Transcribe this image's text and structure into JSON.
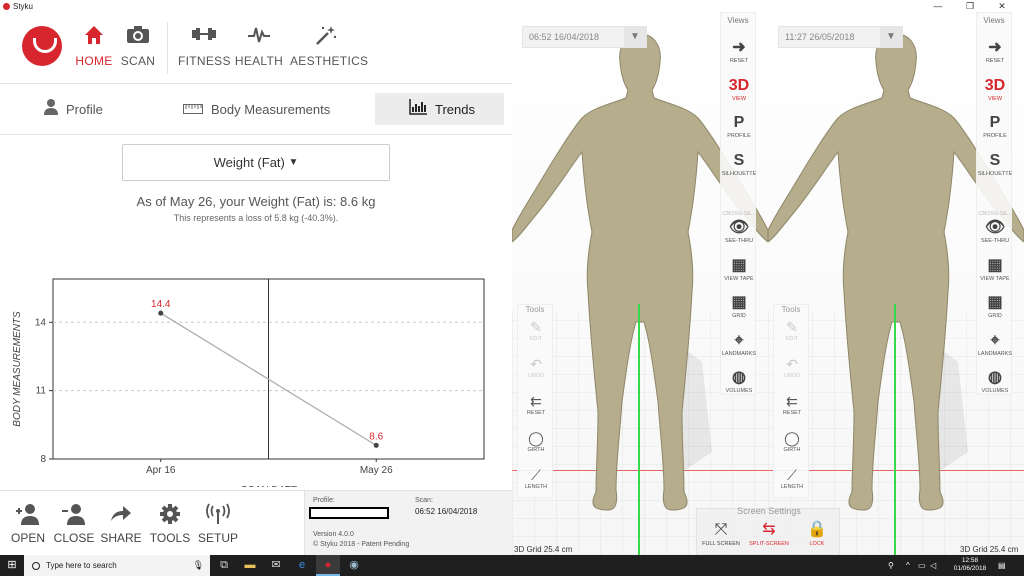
{
  "window": {
    "title": "Styku",
    "controls": {
      "minimize": "—",
      "maximize": "❐",
      "close": "✕"
    }
  },
  "topnav": {
    "items": [
      {
        "label": "HOME",
        "icon": "home-icon",
        "active": true
      },
      {
        "label": "SCAN",
        "icon": "camera-icon"
      },
      {
        "label": "FITNESS",
        "icon": "dumbbell-icon"
      },
      {
        "label": "HEALTH",
        "icon": "heartbeat-icon"
      },
      {
        "label": "AESTHETICS",
        "icon": "magic-wand-icon"
      }
    ]
  },
  "tabs": [
    {
      "label": "Profile",
      "icon": "person-icon"
    },
    {
      "label": "Body Measurements",
      "icon": "ruler-icon"
    },
    {
      "label": "Trends",
      "icon": "chart-icon",
      "active": true
    }
  ],
  "metric_select": {
    "value": "Weight (Fat)",
    "caret": "▼"
  },
  "summary": {
    "line1": "As of May 26, your Weight (Fat) is: 8.6 kg",
    "line2": "This represents a loss of 5.8 kg (-40.3%)."
  },
  "chart_data": {
    "type": "line",
    "categories": [
      "Apr 16",
      "May 26"
    ],
    "series": [
      {
        "values": [
          14.4,
          8.6
        ]
      }
    ],
    "data_labels": [
      "14.4",
      "8.6"
    ],
    "ylabel": "BODY MEASUREMENTS",
    "xlabel": "SCAN DATE",
    "yticks": [
      "8",
      "11",
      "14"
    ],
    "ylim": [
      8,
      15.9
    ],
    "grid": true,
    "colors": {
      "line": "#aaaaaa",
      "point": "#444444",
      "label": "#d7262e"
    }
  },
  "bottombar": {
    "items": [
      {
        "label": "OPEN",
        "icon": "add-person-icon"
      },
      {
        "label": "CLOSE",
        "icon": "remove-person-icon"
      },
      {
        "label": "SHARE",
        "icon": "share-arrow-icon"
      },
      {
        "label": "TOOLS",
        "icon": "gear-icon"
      },
      {
        "label": "SETUP",
        "icon": "wireless-icon"
      }
    ],
    "info": {
      "profile_label": "Profile:",
      "scan_label": "Scan:",
      "scan_value": "06:52 16/04/2018",
      "version": "Version 4.0.0",
      "copyright": "© Styku 2018 - Patent Pending"
    }
  },
  "viewers": [
    {
      "date": "06:52 16/04/2018",
      "grid_label": "3D Grid 25.4 cm"
    },
    {
      "date": "11:27 26/05/2018",
      "grid_label": "3D Grid 25.4 cm"
    }
  ],
  "views_panel": {
    "header": "Views",
    "items": [
      {
        "glyph": "➜",
        "label": "RESET",
        "icon": "reset-arrow-icon"
      },
      {
        "glyph": "3D",
        "label": "VIEW",
        "active": true
      },
      {
        "glyph": "P",
        "label": "PROFILE"
      },
      {
        "glyph": "S",
        "label": "SILHOUETTE"
      },
      {
        "glyph": "👁",
        "label": "SEE-THRU",
        "icon": "eye-icon"
      },
      {
        "glyph": "▦",
        "label": "VIEW TAPE",
        "icon": "tape-icon"
      },
      {
        "glyph": "▦",
        "label": "GRID",
        "icon": "grid-icon"
      },
      {
        "glyph": "⌖",
        "label": "LANDMARKS",
        "icon": "crosshair-icon"
      },
      {
        "glyph": "◍",
        "label": "VOLUMES",
        "icon": "globe-icon"
      }
    ],
    "cross_section": "CROSS-SE..."
  },
  "tools_panel": {
    "header": "Tools",
    "items": [
      {
        "glyph": "✎",
        "label": "EDIT",
        "disabled": true
      },
      {
        "glyph": "↶",
        "label": "UNDO",
        "disabled": true
      },
      {
        "glyph": "⇇",
        "label": "RESET"
      },
      {
        "glyph": "◯",
        "label": "GIRTH"
      },
      {
        "glyph": "⟋",
        "label": "LENGTH"
      }
    ]
  },
  "screen_settings": {
    "header": "Screen Settings",
    "items": [
      {
        "glyph": "⤧",
        "label": "FULL SCREEN"
      },
      {
        "glyph": "⇆",
        "label": "SPLIT-SCREEN",
        "active": true
      },
      {
        "glyph": "🔒",
        "label": "LOCK",
        "active": true
      }
    ]
  },
  "taskbar": {
    "search_placeholder": "Type here to search",
    "clock_time": "12:58",
    "clock_date": "01/06/2018"
  }
}
